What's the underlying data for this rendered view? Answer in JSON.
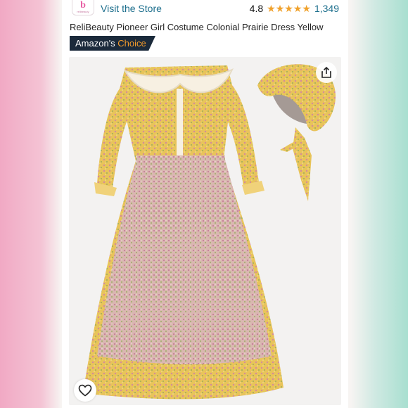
{
  "store": {
    "link_label": "Visit the Store",
    "logo_text": "relibeauty"
  },
  "rating": {
    "value": "4.8",
    "stars_filled": 5,
    "count": "1,349"
  },
  "product": {
    "title": "ReliBeauty Pioneer Girl Costume Colonial Prairie Dress Yellow"
  },
  "badge": {
    "prefix": "Amazon's",
    "highlight": "Choice"
  },
  "colors": {
    "link": "#1d6f8d",
    "star": "#f0a12b",
    "badge_bg": "#1b2a3b",
    "badge_accent": "#f39a2b",
    "dress_yellow": "#e8c45a",
    "apron_pink": "#d9b7b0"
  },
  "icons": {
    "share": "share-icon",
    "favorite": "heart-icon",
    "star": "star-icon"
  }
}
